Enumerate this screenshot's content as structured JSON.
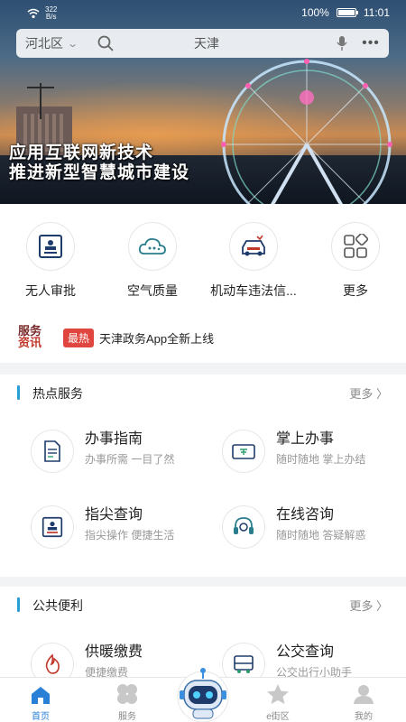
{
  "status_bar": {
    "speed_value": "322",
    "speed_unit": "B/s",
    "battery": "100%",
    "time": "11:01"
  },
  "search": {
    "district": "河北区",
    "query": "天津",
    "icons": [
      "chevron-down-icon",
      "search-icon",
      "microphone-icon",
      "more-icon"
    ]
  },
  "banner": {
    "line1": "应用互联网新技术",
    "line2": "推进新型智慧城市建设"
  },
  "quick_services": [
    {
      "label": "无人审批",
      "icon": "stamp-icon"
    },
    {
      "label": "空气质量",
      "icon": "cloud-icon"
    },
    {
      "label": "机动车违法信...",
      "icon": "car-icon"
    },
    {
      "label": "更多",
      "icon": "grid-more-icon"
    }
  ],
  "news": {
    "logo_line1": "服务",
    "logo_line2": "资讯",
    "tag": "最热",
    "text": "天津政务App全新上线"
  },
  "hot_services": {
    "title": "热点服务",
    "more": "更多",
    "items": [
      {
        "title": "办事指南",
        "subtitle": "办事所需  一目了然",
        "icon": "document-icon"
      },
      {
        "title": "掌上办事",
        "subtitle": "随时随地  掌上办结",
        "icon": "card-icon"
      },
      {
        "title": "指尖查询",
        "subtitle": "指尖操作  便捷生活",
        "icon": "stamp-icon"
      },
      {
        "title": "在线咨询",
        "subtitle": "随时随地  答疑解惑",
        "icon": "headset-icon"
      }
    ]
  },
  "public_convenience": {
    "title": "公共便利",
    "more": "更多",
    "items": [
      {
        "title": "供暖缴费",
        "subtitle": "便捷缴费",
        "icon": "flame-icon"
      },
      {
        "title": "公交查询",
        "subtitle": "公交出行小助手",
        "icon": "bus-icon"
      }
    ]
  },
  "bottom_nav": [
    {
      "label": "首页",
      "icon": "home-icon",
      "active": true
    },
    {
      "label": "服务",
      "icon": "clover-icon",
      "active": false
    },
    {
      "label": "e街区",
      "icon": "star-icon",
      "active": false
    },
    {
      "label": "我的",
      "icon": "person-icon",
      "active": false
    }
  ],
  "colors": {
    "accent": "#2a9fd6",
    "tag_red": "#e0463f",
    "nav_active": "#2a7fd6"
  }
}
